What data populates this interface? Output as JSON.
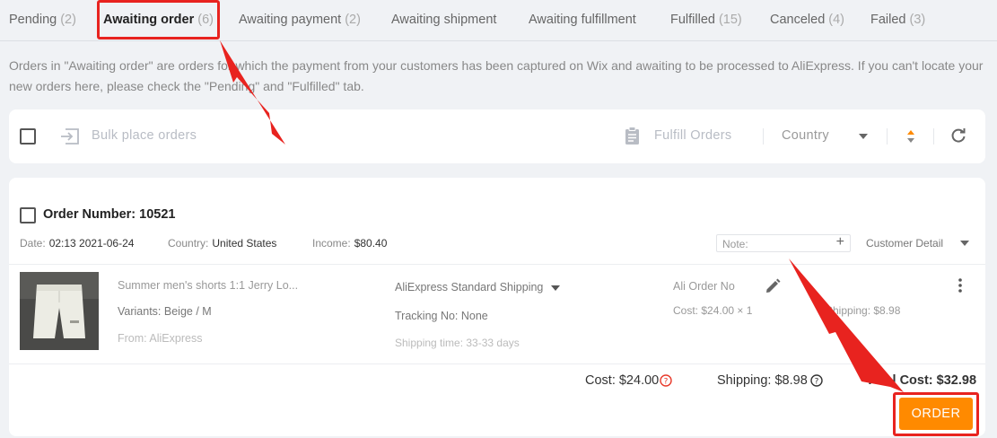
{
  "tabs": [
    {
      "label": "Pending",
      "count": "(2)"
    },
    {
      "label": "Awaiting order",
      "count": "(6)"
    },
    {
      "label": "Awaiting payment",
      "count": "(2)"
    },
    {
      "label": "Awaiting shipment",
      "count": ""
    },
    {
      "label": "Awaiting fulfillment",
      "count": ""
    },
    {
      "label": "Fulfilled",
      "count": "(15)"
    },
    {
      "label": "Canceled",
      "count": "(4)"
    },
    {
      "label": "Failed",
      "count": "(3)"
    }
  ],
  "active_tab": "Awaiting order",
  "notice": "Orders in \"Awaiting order\" are orders for which the payment from your customers has been captured on Wix and awaiting to be processed to AliExpress. If you can't locate your new orders here, please check the \"Pending\" and \"Fulfilled\" tab.",
  "toolbar": {
    "bulk_label": "Bulk place orders",
    "fulfill_label": "Fulfill Orders",
    "country_label": "Country"
  },
  "order": {
    "number_label": "Order Number: 10521",
    "date_label": "Date:",
    "date_value": "02:13 2021-06-24",
    "country_label": "Country:",
    "country_value": "United States",
    "income_label": "Income:",
    "income_value": "$80.40",
    "note_placeholder": "Note:",
    "customer_detail_label": "Customer Detail",
    "item": {
      "title": "Summer men's shorts 1:1 Jerry Lo...",
      "variants": "Variants: Beige / M",
      "source": "From: AliExpress",
      "shipping_method": "AliExpress Standard Shipping",
      "tracking": "Tracking No: None",
      "shipping_time": "Shipping time: 33-33 days",
      "ali_order_no": "Ali Order No",
      "cost_line": "Cost: $24.00 × 1",
      "shipping_line": "Shipping: $8.98"
    },
    "summary": {
      "cost": "Cost: $24.00",
      "shipping": "Shipping: $8.98",
      "total": "Total Cost: $32.98"
    },
    "order_button": "ORDER"
  },
  "colors": {
    "accent": "#ff8a00",
    "annotation_red": "#e8231f",
    "page_background": "#f0f2f5"
  },
  "icons": [
    "bulk-order-icon",
    "clipboard-icon",
    "dropdown-caret-icon",
    "sort-icon",
    "refresh-icon",
    "pencil-icon",
    "kebab-menu-icon",
    "help-icon",
    "annotation-arrow"
  ]
}
